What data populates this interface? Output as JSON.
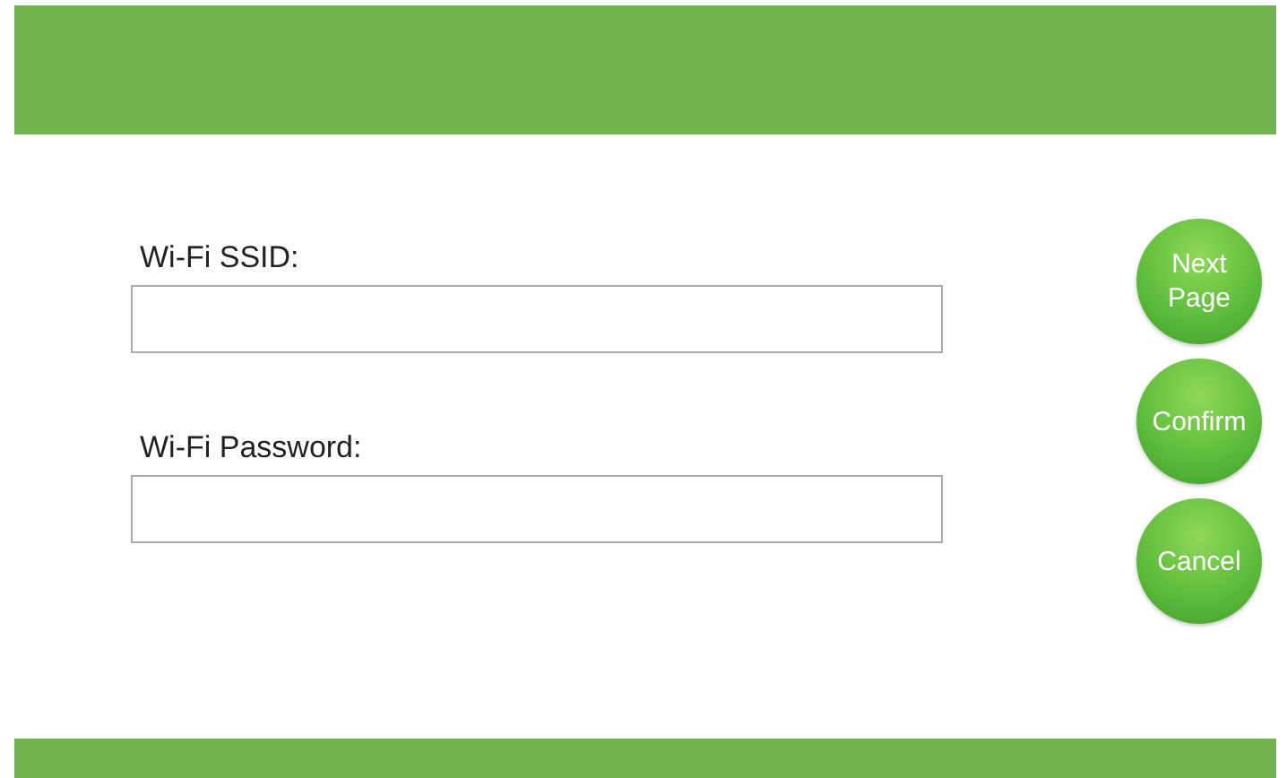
{
  "fields": [
    {
      "label": "Wi-Fi SSID:"
    },
    {
      "label": "Wi-Fi Password:"
    }
  ],
  "buttons": [
    "Next\nPage",
    "Confirm",
    "Cancel"
  ]
}
